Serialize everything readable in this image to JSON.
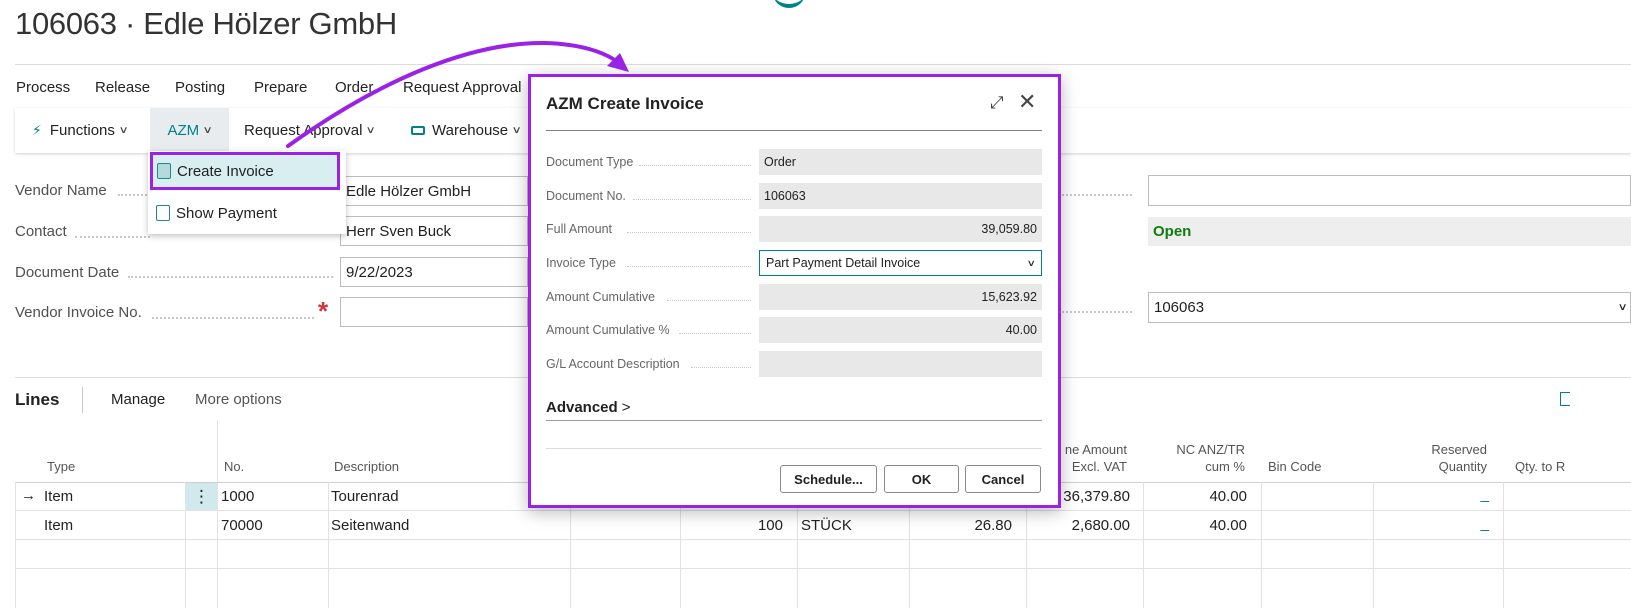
{
  "page_title": "106063 · Edle Hölzer GmbH",
  "menu": [
    "Process",
    "Release",
    "Posting",
    "Prepare",
    "Order",
    "Request Approval"
  ],
  "actionbar": {
    "functions": "Functions",
    "azm": "AZM",
    "request_approval": "Request Approval",
    "warehouse": "Warehouse"
  },
  "azm_dropdown": {
    "create_invoice": "Create Invoice",
    "show_payment": "Show Payment"
  },
  "fields": {
    "vendor_name_label": "Vendor Name",
    "vendor_name": "Edle Hölzer GmbH",
    "contact_label": "Contact",
    "contact": "Herr Sven Buck",
    "document_date_label": "Document Date",
    "document_date": "9/22/2023",
    "vendor_invoice_no_label": "Vendor Invoice No.",
    "vendor_invoice_no": "",
    "required_mark": "*"
  },
  "right_fields": {
    "status": "Open",
    "no_value": "106063"
  },
  "lines": {
    "title": "Lines",
    "tabs": [
      "Manage",
      "More options"
    ],
    "headers": {
      "type": "Type",
      "no": "No.",
      "description": "Description",
      "line_amount": "ne Amount\nExcl. VAT",
      "nc_anz": "NC ANZ/TR\ncum %",
      "bin_code": "Bin Code",
      "reserved_qty": "Reserved\nQuantity",
      "qty_to": "Qty. to R"
    },
    "rows": [
      {
        "arrow": "→",
        "type": "Item",
        "no": "1000",
        "description": "Tourenrad",
        "qty": "",
        "uom": "",
        "unit_cost": "",
        "line_amount": "36,379.80",
        "nc_anz": "40.00",
        "reserved": "_"
      },
      {
        "arrow": "",
        "type": "Item",
        "no": "70000",
        "description": "Seitenwand",
        "qty": "100",
        "uom": "STÜCK",
        "unit_cost": "26.80",
        "line_amount": "2,680.00",
        "nc_anz": "40.00",
        "reserved": "_"
      }
    ],
    "row_menu": "⋮"
  },
  "dialog": {
    "title": "AZM Create Invoice",
    "fields": [
      {
        "label": "Document Type",
        "value": "Order",
        "align": "left"
      },
      {
        "label": "Document No.",
        "value": "106063",
        "align": "left"
      },
      {
        "label": "Full Amount",
        "value": "39,059.80",
        "align": "right"
      }
    ],
    "invoice_type_label": "Invoice Type",
    "invoice_type_value": "Part Payment Detail Invoice",
    "fields2": [
      {
        "label": "Amount Cumulative",
        "value": "15,623.92",
        "align": "right"
      },
      {
        "label": "Amount Cumulative %",
        "value": "40.00",
        "align": "right"
      },
      {
        "label": "G/L Account Description",
        "value": "",
        "align": "left"
      }
    ],
    "advanced": "Advanced",
    "buttons": {
      "schedule": "Schedule...",
      "ok": "OK",
      "cancel": "Cancel"
    }
  },
  "colors": {
    "accent": "#00828a",
    "highlight": "#9a22e6",
    "status_open": "#107c10",
    "required": "#d13438"
  }
}
